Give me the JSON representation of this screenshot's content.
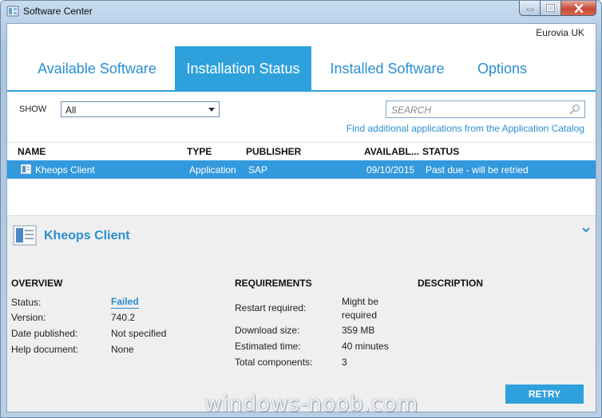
{
  "window": {
    "title": "Software Center"
  },
  "header": {
    "organization": "Eurovia UK"
  },
  "tabs": [
    {
      "label": "Available Software",
      "active": false
    },
    {
      "label": "Installation Status",
      "active": true
    },
    {
      "label": "Installed Software",
      "active": false
    },
    {
      "label": "Options",
      "active": false
    }
  ],
  "filter": {
    "show_label": "SHOW",
    "selected": "All"
  },
  "search": {
    "placeholder": "SEARCH",
    "value": ""
  },
  "catalog_link": "Find additional applications from the Application Catalog",
  "table": {
    "columns": [
      "NAME",
      "TYPE",
      "PUBLISHER",
      "AVAILABL...",
      "STATUS"
    ],
    "rows": [
      {
        "name": "Kheops Client",
        "type": "Application",
        "publisher": "SAP",
        "available": "09/10/2015",
        "status": "Past due - will be retried",
        "selected": true
      }
    ]
  },
  "details": {
    "title": "Kheops Client",
    "overview": {
      "heading": "OVERVIEW",
      "status_label": "Status:",
      "status_value": "Failed",
      "version_label": "Version:",
      "version_value": "740.2",
      "published_label": "Date published:",
      "published_value": "Not specified",
      "help_label": "Help document:",
      "help_value": "None"
    },
    "requirements": {
      "heading": "REQUIREMENTS",
      "restart_label": "Restart required:",
      "restart_value_line1": "Might be",
      "restart_value_line2": "required",
      "download_label": "Download size:",
      "download_value": "359 MB",
      "time_label": "Estimated time:",
      "time_value": "40 minutes",
      "components_label": "Total components:",
      "components_value": "3"
    },
    "description": {
      "heading": "DESCRIPTION"
    },
    "retry_label": "RETRY"
  },
  "watermark": "windows-noob.com",
  "colors": {
    "accent": "#2ea1dc",
    "link": "#2a8fd0",
    "selected_row": "#3399dd"
  },
  "icons": [
    "software-center-icon",
    "minimize-icon",
    "maximize-icon",
    "close-icon",
    "dropdown-arrow-icon",
    "search-icon",
    "application-icon",
    "collapse-chevron-icon"
  ]
}
